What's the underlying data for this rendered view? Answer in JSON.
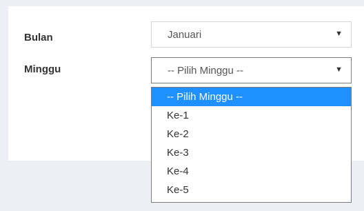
{
  "form": {
    "bulan_label": "Bulan",
    "bulan_value": "Januari",
    "minggu_label": "Minggu",
    "minggu_value": "-- Pilih Minggu --"
  },
  "minggu_options": [
    "-- Pilih Minggu --",
    "Ke-1",
    "Ke-2",
    "Ke-3",
    "Ke-4",
    "Ke-5"
  ],
  "selected_index": 0,
  "icons": {
    "caret": "caret-down-icon"
  },
  "colors": {
    "highlight": "#1e90ff",
    "background": "#ecf0f5"
  }
}
